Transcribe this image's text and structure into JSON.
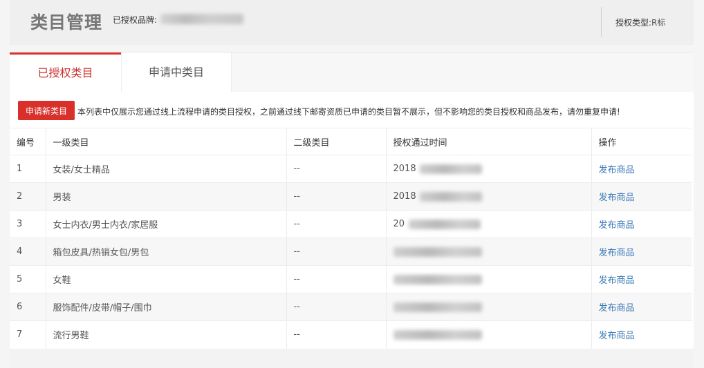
{
  "header": {
    "title": "类目管理",
    "brand_label": "已授权品牌:",
    "auth_type_label": "授权类型:",
    "auth_type_value": "R标"
  },
  "tabs": [
    {
      "label": "已授权类目",
      "active": true
    },
    {
      "label": "申请中类目",
      "active": false
    }
  ],
  "toolbar": {
    "apply_button_label": "申请新类目",
    "notice": "本列表中仅展示您通过线上流程申请的类目授权，之前通过线下邮寄资质已申请的类目暂不展示，但不影响您的类目授权和商品发布，请勿重复申请!"
  },
  "table": {
    "headers": [
      "编号",
      "一级类目",
      "二级类目",
      "授权通过时间",
      "操作"
    ],
    "rows": [
      {
        "no": "1",
        "category1": "女装/女士精品",
        "category2": "--",
        "time_visible": "2018",
        "action": "发布商品"
      },
      {
        "no": "2",
        "category1": "男装",
        "category2": "--",
        "time_visible": "2018",
        "action": "发布商品"
      },
      {
        "no": "3",
        "category1": "女士内衣/男士内衣/家居服",
        "category2": "--",
        "time_visible": "20",
        "action": "发布商品"
      },
      {
        "no": "4",
        "category1": "箱包皮具/热销女包/男包",
        "category2": "--",
        "time_visible": "",
        "action": "发布商品"
      },
      {
        "no": "5",
        "category1": "女鞋",
        "category2": "--",
        "time_visible": "",
        "action": "发布商品"
      },
      {
        "no": "6",
        "category1": "服饰配件/皮带/帽子/围巾",
        "category2": "--",
        "time_visible": "",
        "action": "发布商品"
      },
      {
        "no": "7",
        "category1": "流行男鞋",
        "category2": "--",
        "time_visible": "",
        "action": "发布商品"
      }
    ]
  },
  "colors": {
    "accent": "#d9302c",
    "link": "#3b78b8"
  }
}
